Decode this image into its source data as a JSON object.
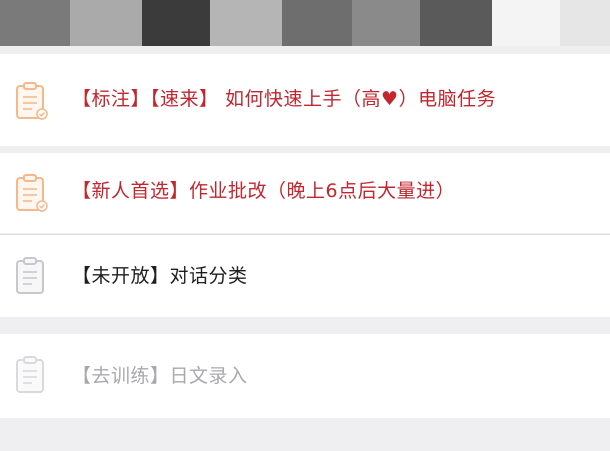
{
  "tasks": [
    {
      "label": "【标注】【速来】 如何快速上手（高♥）电脑任务",
      "status": "active",
      "icon": "clipboard-icon-orange"
    },
    {
      "label": "【新人首选】作业批改（晚上6点后大量进）",
      "status": "active",
      "icon": "clipboard-icon-orange"
    },
    {
      "label": "【未开放】对话分类",
      "status": "closed",
      "icon": "clipboard-icon-gray"
    },
    {
      "label": "【去训练】日文录入",
      "status": "training",
      "icon": "clipboard-icon-light-gray"
    }
  ],
  "colors": {
    "active_text": "#c3262e",
    "closed_text": "#1f1f1f",
    "training_text": "#a9a9ad",
    "background": "#efeff1",
    "card": "#ffffff",
    "icon_orange": "#f3b98a",
    "icon_gray": "#c7c7cc"
  }
}
